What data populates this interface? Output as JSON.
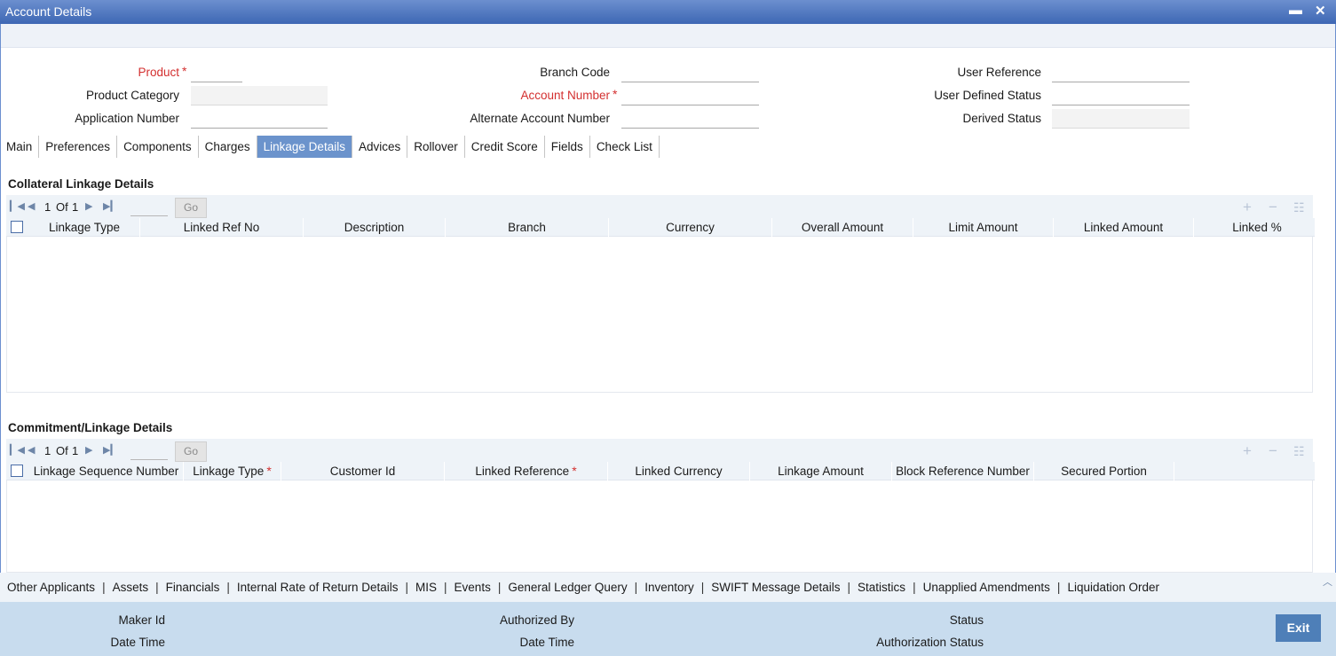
{
  "window": {
    "title": "Account Details",
    "minimize": "▬",
    "close": "✕"
  },
  "header": {
    "product_label": "Product",
    "product_value": "",
    "product_category_label": "Product Category",
    "product_category_value": "",
    "application_number_label": "Application Number",
    "application_number_value": "",
    "branch_code_label": "Branch Code",
    "branch_code_value": "",
    "account_number_label": "Account Number",
    "account_number_value": "",
    "alternate_account_number_label": "Alternate Account Number",
    "alternate_account_number_value": "",
    "user_reference_label": "User Reference",
    "user_reference_value": "",
    "user_defined_status_label": "User Defined Status",
    "user_defined_status_value": "",
    "derived_status_label": "Derived Status",
    "derived_status_value": "",
    "required_marker": "*"
  },
  "tabs": [
    {
      "label": "Main"
    },
    {
      "label": "Preferences"
    },
    {
      "label": "Components"
    },
    {
      "label": "Charges"
    },
    {
      "label": "Linkage Details",
      "active": true
    },
    {
      "label": "Advices"
    },
    {
      "label": "Rollover"
    },
    {
      "label": "Credit Score"
    },
    {
      "label": "Fields"
    },
    {
      "label": "Check List"
    }
  ],
  "collateral": {
    "title": "Collateral Linkage Details",
    "pager": {
      "current": "1",
      "of_label": "Of",
      "total": "1",
      "go_label": "Go"
    },
    "columns": [
      "Linkage Type",
      "Linked Ref No",
      "Description",
      "Branch",
      "Currency",
      "Overall Amount",
      "Limit Amount",
      "Linked Amount",
      "Linked %"
    ],
    "rows": []
  },
  "commitment": {
    "title": "Commitment/Linkage Details",
    "pager": {
      "current": "1",
      "of_label": "Of",
      "total": "1",
      "go_label": "Go"
    },
    "columns": [
      "Linkage Sequence Number",
      "Linkage Type",
      "Customer Id",
      "Linked Reference",
      "Linked Currency",
      "Linkage Amount",
      "Block Reference Number",
      "Secured Portion"
    ],
    "rows": []
  },
  "icons": {
    "first": "first-page-icon",
    "prev": "prev-page-icon",
    "next": "next-page-icon",
    "last": "last-page-icon",
    "add": "add-row-icon",
    "delete": "delete-row-icon",
    "view": "single-view-icon"
  },
  "bottom_links": [
    "Other Applicants",
    "Assets",
    "Financials",
    "Internal Rate of Return Details",
    "MIS",
    "Events",
    "General Ledger Query",
    "Inventory",
    "SWIFT Message Details",
    "Statistics",
    "Unapplied Amendments",
    "Liquidation Order"
  ],
  "footer": {
    "maker_id_label": "Maker Id",
    "date_time_label": "Date Time",
    "authorized_by_label": "Authorized By",
    "date_time2_label": "Date Time",
    "status_label": "Status",
    "authorization_status_label": "Authorization Status",
    "exit_label": "Exit"
  }
}
